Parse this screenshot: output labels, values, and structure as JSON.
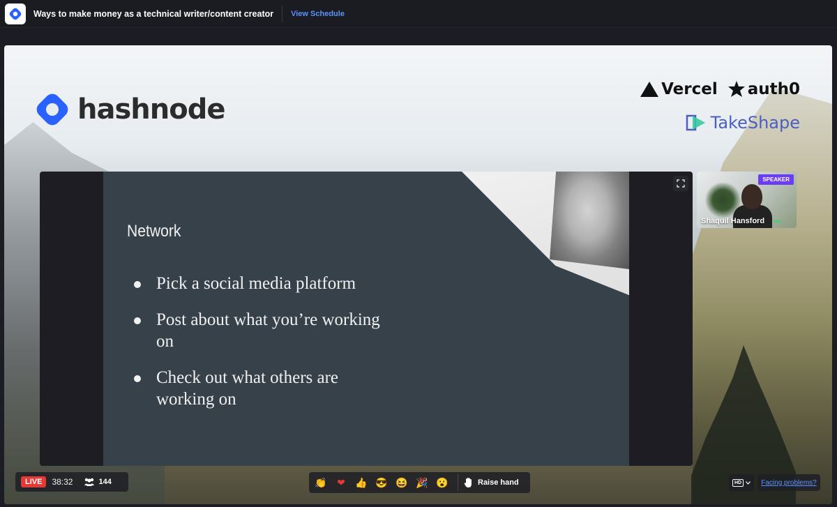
{
  "header": {
    "event_title": "Ways to make money as a technical writer/content creator",
    "view_schedule_label": "View Schedule"
  },
  "brand": {
    "hashnode": "hashnode",
    "sponsors": [
      "Vercel",
      "auth0"
    ],
    "takeshape": "TakeShape"
  },
  "slide": {
    "heading": "Network",
    "bullets": [
      "Pick a social media platform",
      "Post about what you’re working on",
      "Check out what others are working on"
    ]
  },
  "speaker": {
    "badge": "SPEAKER",
    "name": "Shaquil Hansford"
  },
  "controls": {
    "live_label": "LIVE",
    "timer": "38:32",
    "attendee_count": "144",
    "reactions": [
      "clap-icon",
      "heart-icon",
      "thumbs-up-icon",
      "cool-face-icon",
      "laugh-face-icon",
      "party-icon",
      "wow-icon"
    ],
    "raise_hand_label": "Raise hand",
    "quality_label": "HD",
    "facing_problems_label": "Facing problems?"
  },
  "colors": {
    "accent": "#5a93ff",
    "live_red": "#e53935",
    "speaker_purple": "#6b3df0",
    "hashnode_blue": "#2962ff"
  }
}
